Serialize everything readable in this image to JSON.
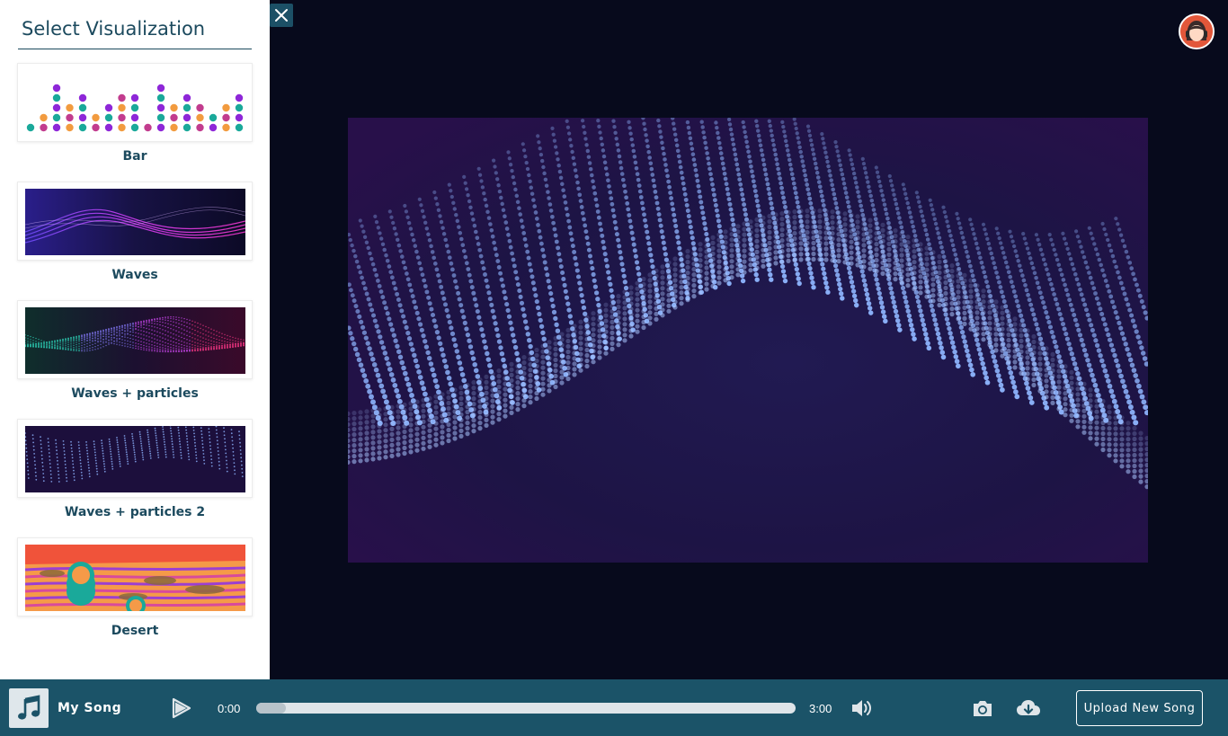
{
  "sidebar": {
    "title": "Select Visualization",
    "items": [
      {
        "label": "Bar"
      },
      {
        "label": "Waves"
      },
      {
        "label": "Waves + particles"
      },
      {
        "label": "Waves + particles 2"
      },
      {
        "label": "Desert"
      }
    ]
  },
  "player": {
    "song_title": "My Song",
    "time_current": "0:00",
    "time_total": "3:00",
    "progress": 0.055,
    "upload_label": "Upload New Song"
  },
  "colors": {
    "sidebar_text": "#1c4a5e",
    "player_bg": "#1b5368",
    "stage_bg": "#070a1c",
    "accent_orange": "#f29b3f",
    "accent_pink": "#c23c8e",
    "accent_teal": "#1aa99a",
    "accent_purple": "#8e27d8"
  },
  "icons": {
    "close": "close-icon",
    "avatar": "user-avatar-icon",
    "music": "music-note-icon",
    "play": "play-icon",
    "volume": "volume-icon",
    "camera": "camera-icon",
    "download": "cloud-download-icon"
  }
}
